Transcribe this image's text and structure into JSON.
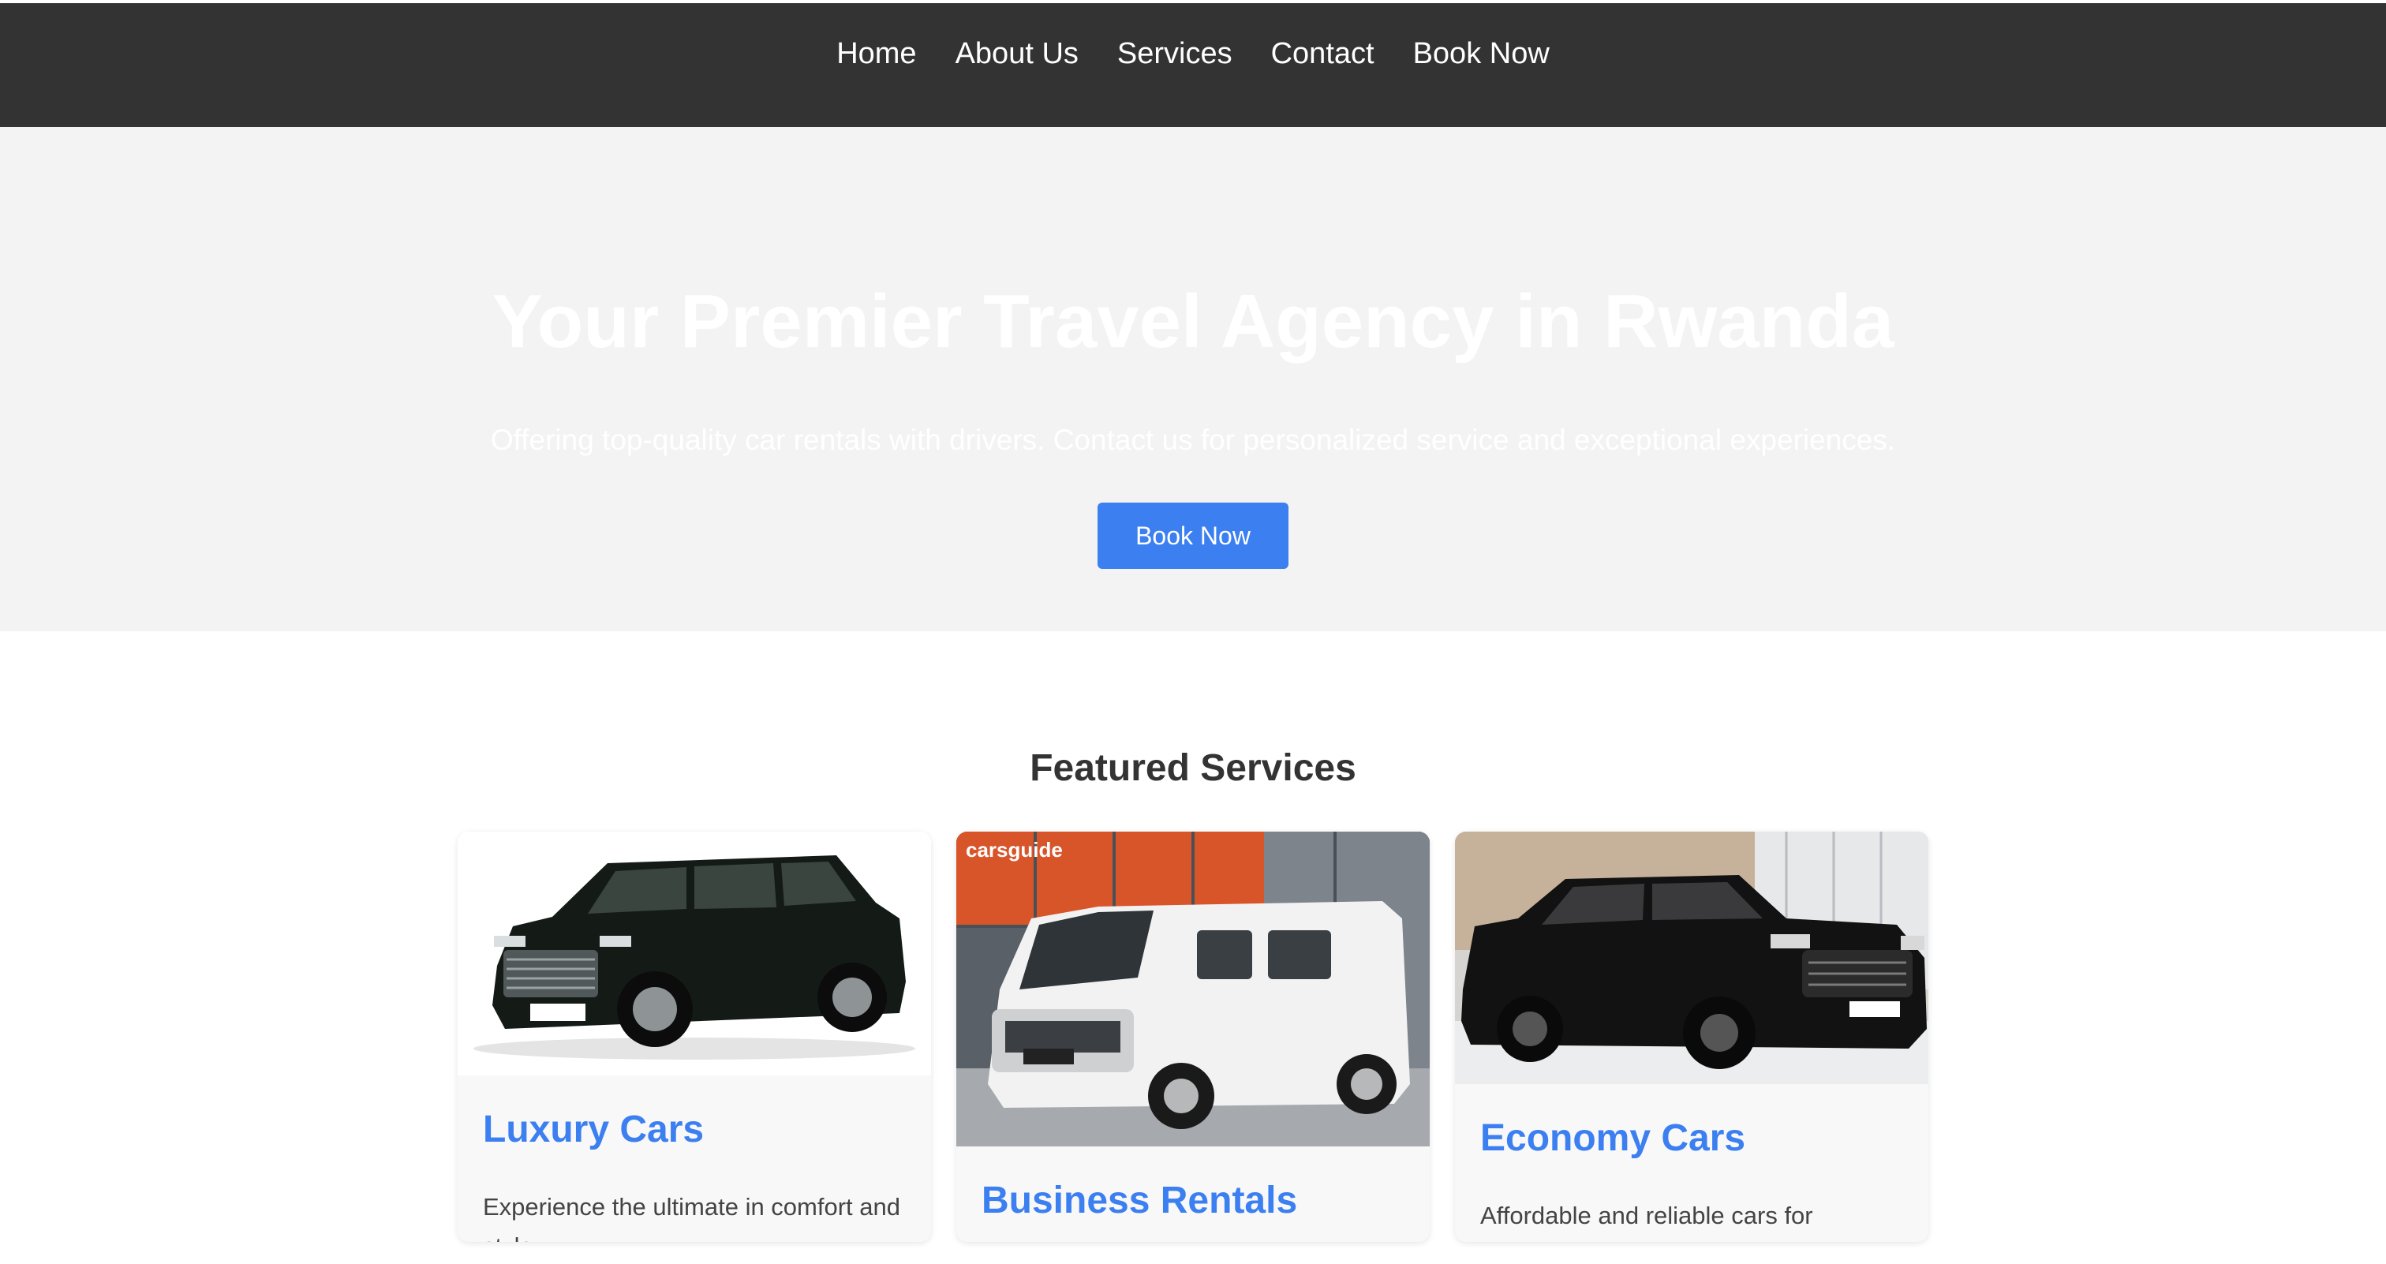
{
  "nav": {
    "items": [
      {
        "label": "Home"
      },
      {
        "label": "About Us"
      },
      {
        "label": "Services"
      },
      {
        "label": "Contact"
      },
      {
        "label": "Book Now"
      }
    ]
  },
  "hero": {
    "title": "Your Premier Travel Agency in Rwanda",
    "subtitle": "Offering top-quality car rentals with drivers. Contact us for personalized service and exceptional experiences.",
    "button_label": "Book Now"
  },
  "featured": {
    "title": "Featured Services",
    "cards": [
      {
        "title": "Luxury Cars",
        "description": "Experience the ultimate in comfort and style.",
        "image": "black-luxury-suv"
      },
      {
        "title": "Business Rentals",
        "description": "",
        "image": "white-van",
        "image_watermark": "carsguide"
      },
      {
        "title": "Economy Cars",
        "description": "Affordable and reliable cars for everyday use.",
        "image": "black-pickup-truck"
      }
    ]
  },
  "colors": {
    "nav_bg": "#333333",
    "hero_bg": "#f3f3f3",
    "accent": "#3b7ff0"
  }
}
